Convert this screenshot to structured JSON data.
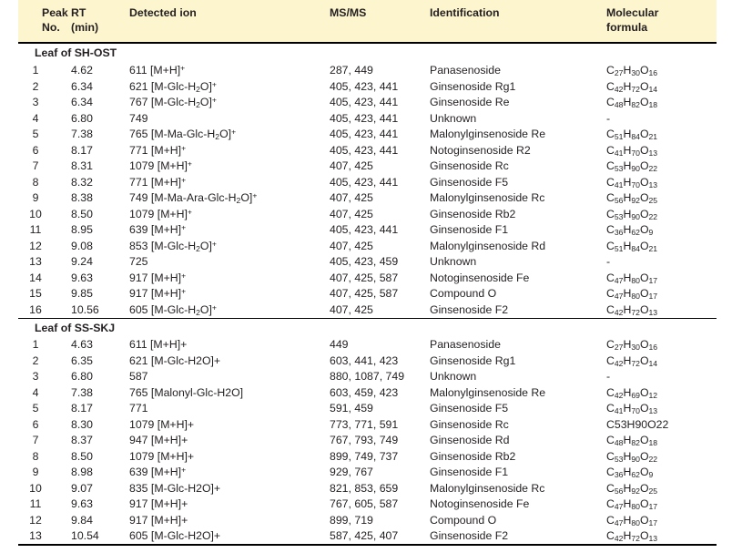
{
  "header": {
    "columns": [
      {
        "id": "peak",
        "line1": "Peak",
        "line2": "No."
      },
      {
        "id": "rt",
        "line1": "RT",
        "line2": "(min)"
      },
      {
        "id": "ion",
        "line1": "Detected  ion",
        "line2": ""
      },
      {
        "id": "msms",
        "line1": "MS/MS",
        "line2": ""
      },
      {
        "id": "identification",
        "line1": "Identification",
        "line2": ""
      },
      {
        "id": "formula",
        "line1": "Molecular",
        "line2": "formula"
      }
    ],
    "background_color": "#fdf5ce"
  },
  "sections": [
    {
      "label": "Leaf of SH-OST",
      "rows": [
        {
          "no": "1",
          "rt": "4.62",
          "ion": "611 [M+H]<sup>+</sup>",
          "msms": "287, 449",
          "identification": "Panasenoside",
          "formula": "C<sub>27</sub>H<sub>30</sub>O<sub>16</sub>"
        },
        {
          "no": "2",
          "rt": "6.34",
          "ion": "621 [M-Glc-H<sub>2</sub>O]<sup>+</sup>",
          "msms": "405, 423, 441",
          "identification": "Ginsenoside Rg1",
          "formula": "C<sub>42</sub>H<sub>72</sub>O<sub>14</sub>"
        },
        {
          "no": "3",
          "rt": "6.34",
          "ion": "767 [M-Glc-H<sub>2</sub>O]<sup>+</sup>",
          "msms": "405, 423, 441",
          "identification": "Ginsenoside Re",
          "formula": "C<sub>48</sub>H<sub>82</sub>O<sub>18</sub>"
        },
        {
          "no": "4",
          "rt": "6.80",
          "ion": "749",
          "msms": "405, 423, 441",
          "identification": "Unknown",
          "formula": "-"
        },
        {
          "no": "5",
          "rt": "7.38",
          "ion": "765 [M-Ma-Glc-H<sub>2</sub>O]<sup>+</sup>",
          "msms": "405, 423, 441",
          "identification": "Malonylginsenoside  Re",
          "formula": "C<sub>51</sub>H<sub>84</sub>O<sub>21</sub>"
        },
        {
          "no": "6",
          "rt": "8.17",
          "ion": "771 [M+H]<sup>+</sup>",
          "msms": "405, 423, 441",
          "identification": "Notoginsenoside R2",
          "formula": "C<sub>41</sub>H<sub>70</sub>O<sub>13</sub>"
        },
        {
          "no": "7",
          "rt": "8.31",
          "ion": "1079  [M+H]<sup>+</sup>",
          "msms": "407, 425",
          "identification": "Ginsenoside Rc",
          "formula": "C<sub>53</sub>H<sub>90</sub>O<sub>22</sub>"
        },
        {
          "no": "8",
          "rt": "8.32",
          "ion": "771 [M+H]<sup>+</sup>",
          "msms": "405, 423, 441",
          "identification": "Ginsenoside F5",
          "formula": "C<sub>41</sub>H<sub>70</sub>O<sub>13</sub>"
        },
        {
          "no": "9",
          "rt": "8.38",
          "ion": "749 [M-Ma-Ara-Glc-H<sub>2</sub>O]<sup>+</sup>",
          "msms": "407, 425",
          "identification": "Malonylginsenoside  Rc",
          "formula": "C<sub>56</sub>H<sub>92</sub>O<sub>25</sub>"
        },
        {
          "no": "10",
          "rt": "8.50",
          "ion": "1079  [M+H]<sup>+</sup>",
          "msms": "407, 425",
          "identification": "Ginsenoside Rb2",
          "formula": "C<sub>53</sub>H<sub>90</sub>O<sub>22</sub>"
        },
        {
          "no": "11",
          "rt": "8.95",
          "ion": "639 [M+H]<sup>+</sup>",
          "msms": "405, 423, 441",
          "identification": "Ginsenoside F1",
          "formula": "C<sub>36</sub>H<sub>62</sub>O<sub>9</sub>"
        },
        {
          "no": "12",
          "rt": "9.08",
          "ion": "853 [M-Glc-H<sub>2</sub>O]<sup>+</sup>",
          "msms": "407, 425",
          "identification": "Malonylginsenoside  Rd",
          "formula": "C<sub>51</sub>H<sub>84</sub>O<sub>21</sub>"
        },
        {
          "no": "13",
          "rt": "9.24",
          "ion": "725",
          "msms": "405, 423, 459",
          "identification": "Unknown",
          "formula": "-"
        },
        {
          "no": "14",
          "rt": "9.63",
          "ion": "917 [M+H]<sup>+</sup>",
          "msms": "407, 425, 587",
          "identification": "Notoginsenoside Fe",
          "formula": "C<sub>47</sub>H<sub>80</sub>O<sub>17</sub>"
        },
        {
          "no": "15",
          "rt": "9.85",
          "ion": "917 [M+H]<sup>+</sup>",
          "msms": "407, 425, 587",
          "identification": "Compound O",
          "formula": "C<sub>47</sub>H<sub>80</sub>O<sub>17</sub>"
        },
        {
          "no": "16",
          "rt": "10.56",
          "ion": "605 [M-Glc-H<sub>2</sub>O]<sup>+</sup>",
          "msms": "407, 425",
          "identification": "Ginsenoside F2",
          "formula": "C<sub>42</sub>H<sub>72</sub>O<sub>13</sub>"
        }
      ]
    },
    {
      "label": "Leaf of SS-SKJ",
      "rows": [
        {
          "no": "1",
          "rt": "4.63",
          "ion": "611 [M+H]+",
          "msms": "449",
          "identification": "Panasenoside",
          "formula": "C<sub>27</sub>H<sub>30</sub>O<sub>16</sub>"
        },
        {
          "no": "2",
          "rt": "6.35",
          "ion": "621 [M-Glc-H2O]+",
          "msms": "603, 441, 423",
          "identification": "Ginsenoside Rg1",
          "formula": "C<sub>42</sub>H<sub>72</sub>O<sub>14</sub>"
        },
        {
          "no": "3",
          "rt": "6.80",
          "ion": "587",
          "msms": "880, 1087, 749",
          "identification": "Unknown",
          "formula": "-"
        },
        {
          "no": "4",
          "rt": "7.38",
          "ion": "765 [Malonyl-Glc-H2O]",
          "msms": "603, 459, 423",
          "identification": "Malonylginsenoside  Re",
          "formula": "C<sub>42</sub>H<sub>69</sub>O<sub>12</sub>"
        },
        {
          "no": "5",
          "rt": "8.17",
          "ion": "771",
          "msms": "591, 459",
          "identification": "Ginsenoside F5",
          "formula": "C<sub>41</sub>H<sub>70</sub>O<sub>13</sub>"
        },
        {
          "no": "6",
          "rt": "8.30",
          "ion": "1079  [M+H]+",
          "msms": "773, 771, 591",
          "identification": "Ginsenoside Rc",
          "formula": "C53H90O22"
        },
        {
          "no": "7",
          "rt": "8.37",
          "ion": "947 [M+H]+",
          "msms": "767, 793, 749",
          "identification": "Ginsenoside Rd",
          "formula": "C<sub>48</sub>H<sub>82</sub>O<sub>18</sub>"
        },
        {
          "no": "8",
          "rt": "8.50",
          "ion": "1079  [M+H]+",
          "msms": "899, 749, 737",
          "identification": "Ginsenoside Rb2",
          "formula": "C<sub>53</sub>H<sub>90</sub>O<sub>22</sub>"
        },
        {
          "no": "9",
          "rt": "8.98",
          "ion": "639 [M+H]<sup>+</sup>",
          "msms": "929, 767",
          "identification": "Ginsenoside F1",
          "formula": "C<sub>36</sub>H<sub>62</sub>O<sub>9</sub>"
        },
        {
          "no": "10",
          "rt": "9.07",
          "ion": "835 [M-Glc-H2O]+",
          "msms": "821, 853, 659",
          "identification": "Malonylginsenoside  Rc",
          "formula": "C<sub>56</sub>H<sub>92</sub>O<sub>25</sub>"
        },
        {
          "no": "11",
          "rt": "9.63",
          "ion": "917 [M+H]+",
          "msms": "767, 605, 587",
          "identification": "Notoginsenoside Fe",
          "formula": "C<sub>47</sub>H<sub>80</sub>O<sub>17</sub>"
        },
        {
          "no": "12",
          "rt": "9.84",
          "ion": "917 [M+H]+",
          "msms": "899, 719",
          "identification": "Compound O",
          "formula": "C<sub>47</sub>H<sub>80</sub>O<sub>17</sub>"
        },
        {
          "no": "13",
          "rt": "10.54",
          "ion": "605 [M-Glc-H2O]+",
          "msms": "587, 425, 407",
          "identification": "Ginsenoside F2",
          "formula": "C<sub>42</sub>H<sub>72</sub>O<sub>13</sub>"
        }
      ]
    }
  ]
}
